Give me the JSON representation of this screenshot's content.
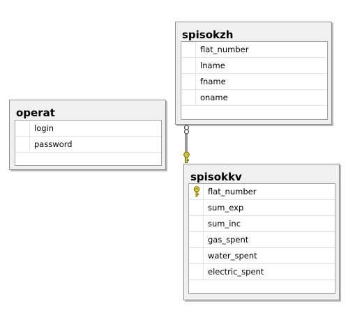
{
  "tables": {
    "operat": {
      "title": "operat",
      "columns": [
        "login",
        "password"
      ]
    },
    "spisokzh": {
      "title": "spisokzh",
      "columns": [
        "flat_number",
        "lname",
        "fname",
        "oname"
      ]
    },
    "spisokkv": {
      "title": "spisokkv",
      "columns": [
        "flat_number",
        "sum_exp",
        "sum_inc",
        "gas_spent",
        "water_spent",
        "electric_spent"
      ],
      "primary_key": "flat_number"
    }
  },
  "relationships": [
    {
      "from": "spisokzh",
      "to": "spisokkv",
      "from_end": "many",
      "to_end": "one"
    }
  ],
  "colors": {
    "box_bg": "#f0f0f0",
    "box_border": "#8e8e8e",
    "key_icon": "#f2e600",
    "relation_line": "#555555"
  },
  "icons": {
    "primary_key": "key-icon",
    "many_end": "infinity-icon",
    "one_end": "key-icon"
  }
}
